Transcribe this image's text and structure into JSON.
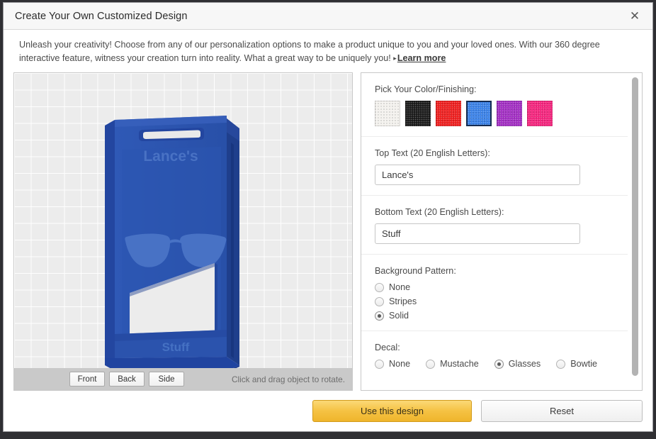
{
  "dialog": {
    "title": "Create Your Own Customized Design",
    "close_icon": "close-icon"
  },
  "intro": {
    "paragraph": "Unleash your creativity! Choose from any of our personalization options to make a product unique to you and your loved ones. With our 360 degree interactive feature, witness your creation turn into reality. What a great way to be uniquely you!",
    "arrow": "▸",
    "learn_more": "Learn more"
  },
  "viewer": {
    "buttons": [
      {
        "label": "Front"
      },
      {
        "label": "Back"
      },
      {
        "label": "Side"
      }
    ],
    "hint": "Click and drag object to rotate.",
    "model": {
      "body_color": "#2b53ad",
      "top_text": "Lance's",
      "bottom_text": "Stuff",
      "decal": "glasses"
    }
  },
  "options": {
    "color": {
      "label": "Pick Your Color/Finishing:",
      "swatches": [
        {
          "name": "white",
          "hex": "#f4f2ee",
          "selected": false
        },
        {
          "name": "black",
          "hex": "#1b1b1b",
          "selected": false
        },
        {
          "name": "red",
          "hex": "#ef2020",
          "selected": false
        },
        {
          "name": "blue",
          "hex": "#3b82e8",
          "selected": true
        },
        {
          "name": "purple",
          "hex": "#a32fc4",
          "selected": false
        },
        {
          "name": "pink",
          "hex": "#f5257e",
          "selected": false
        }
      ]
    },
    "top_text": {
      "label": "Top Text (20 English Letters):",
      "value": "Lance's",
      "placeholder": ""
    },
    "bottom_text": {
      "label": "Bottom Text (20 English Letters):",
      "value": "Stuff",
      "placeholder": ""
    },
    "background_pattern": {
      "label": "Background Pattern:",
      "options": [
        {
          "label": "None",
          "checked": false
        },
        {
          "label": "Stripes",
          "checked": false
        },
        {
          "label": "Solid",
          "checked": true
        }
      ]
    },
    "decal": {
      "label": "Decal:",
      "options": [
        {
          "label": "None",
          "checked": false
        },
        {
          "label": "Mustache",
          "checked": false
        },
        {
          "label": "Glasses",
          "checked": true
        },
        {
          "label": "Bowtie",
          "checked": false
        }
      ]
    }
  },
  "footer": {
    "primary_label": "Use this design",
    "secondary_label": "Reset"
  }
}
